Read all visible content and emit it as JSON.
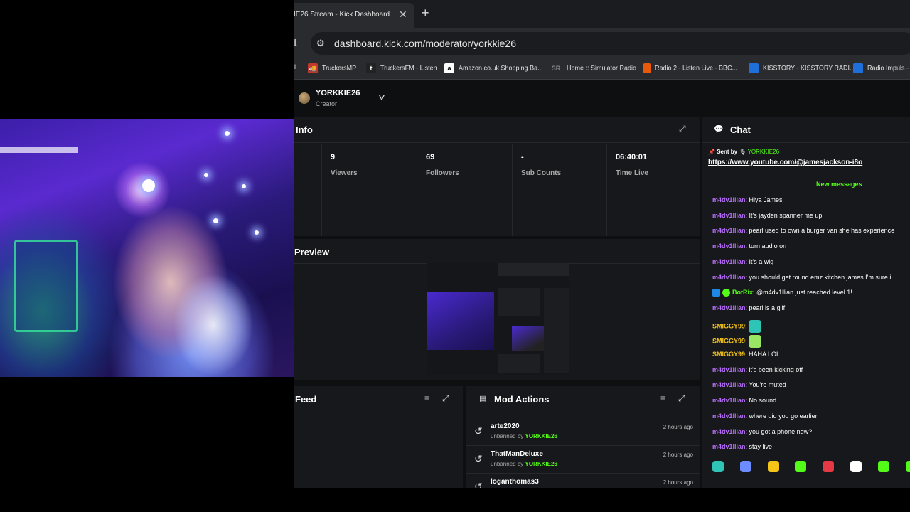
{
  "browser": {
    "tab_title": "IE26 Stream - Kick Dashboard",
    "tab_close": "✕",
    "new_tab": "+",
    "back_glyph": "ℹ",
    "url": "dashboard.kick.com/moderator/yorkkie26",
    "bookmarks": [
      {
        "label": "TruckersMP",
        "icon": "T",
        "color": "#c0392b"
      },
      {
        "label": "TruckersFM - Listen",
        "icon": "t",
        "color": "#222222"
      },
      {
        "label": "Amazon.co.uk Shopping Ba...",
        "icon": "a",
        "color": "#ffffff"
      },
      {
        "label": "Home :: Simulator Radio",
        "icon": "SR",
        "color": "#555555"
      },
      {
        "label": "Radio 2 - Listen Live - BBC...",
        "icon": "",
        "color": "#e8590c"
      },
      {
        "label": "KISSTORY - KISSTORY RADI...",
        "icon": "",
        "color": "#1e6fd9"
      },
      {
        "label": "Radio Impuls - L",
        "icon": "",
        "color": "#1e6fd9"
      }
    ],
    "bookmark_first_fragment": "il"
  },
  "user": {
    "name": "YORKKIE26",
    "role": "Creator"
  },
  "info": {
    "title": "Info",
    "stats": [
      {
        "value": "9",
        "label": "Viewers"
      },
      {
        "value": "69",
        "label": "Followers"
      },
      {
        "value": "-",
        "label": "Sub Counts"
      },
      {
        "value": "06:40:01",
        "label": "Time Live"
      }
    ]
  },
  "preview": {
    "title": "Preview"
  },
  "feed": {
    "title": "Feed"
  },
  "mod_actions": {
    "title": "Mod Actions",
    "items": [
      {
        "name": "arte2020",
        "action": "unbanned by",
        "by": "YORKKIE26",
        "time": "2 hours ago"
      },
      {
        "name": "ThatManDeluxe",
        "action": "unbanned by",
        "by": "YORKKIE26",
        "time": "2 hours ago"
      },
      {
        "name": "loganthomas3",
        "action": "",
        "by": "",
        "time": "2 hours ago"
      }
    ]
  },
  "chat": {
    "title": "Chat",
    "pinned_sent_by": "Sent by",
    "pinned_user": "YORKKIE26",
    "pinned_link": "https://www.youtube.com/@jamesjackson-i8o",
    "new_messages": "New messages",
    "messages": [
      {
        "user": "m4dv1llian",
        "text": "Hiya James",
        "color": "#b46cf7"
      },
      {
        "user": "m4dv1llian",
        "text": "It's jayden spanner me up",
        "color": "#b46cf7"
      },
      {
        "user": "m4dv1llian",
        "text": "pearl used to own a burger van she has experience",
        "color": "#b46cf7"
      },
      {
        "user": "m4dv1llian",
        "text": "turn audio on",
        "color": "#b46cf7"
      },
      {
        "user": "m4dv1llian",
        "text": "It's a wig",
        "color": "#b46cf7"
      },
      {
        "user": "m4dv1llian",
        "text": "you should get round emz kitchen james I'm sure i",
        "color": "#b46cf7"
      },
      {
        "user": "BotRix",
        "text": "@m4dv1llian just reached level 1!",
        "color": "#53fc18",
        "badges": true
      },
      {
        "user": "m4dv1llian",
        "text": "pearl is a gilf",
        "color": "#b46cf7"
      },
      {
        "user": "SMIGGY99",
        "text": "",
        "color": "#f5c518",
        "emote": "#2ec4b6"
      },
      {
        "user": "SMIGGY99",
        "text": "",
        "color": "#f5c518",
        "emote": "#9be564"
      },
      {
        "user": "SMIGGY99",
        "text": "HAHA LOL",
        "color": "#f5c518"
      },
      {
        "user": "m4dv1llian",
        "text": "it's been kicking off",
        "color": "#b46cf7"
      },
      {
        "user": "m4dv1llian",
        "text": "You're muted",
        "color": "#b46cf7"
      },
      {
        "user": "m4dv1llian",
        "text": "No sound",
        "color": "#b46cf7"
      },
      {
        "user": "m4dv1llian",
        "text": "where did you go earlier",
        "color": "#b46cf7"
      },
      {
        "user": "m4dv1llian",
        "text": "you got a phone now?",
        "color": "#b46cf7"
      },
      {
        "user": "m4dv1llian",
        "text": "stay live",
        "color": "#b46cf7"
      }
    ],
    "emote_colors": [
      "#2ec4b6",
      "#6c8cff",
      "#f5c518",
      "#53fc18",
      "#e63946",
      "#ffffff",
      "#53fc18",
      "#53fc18"
    ]
  },
  "colors": {
    "accent": "#53fc18",
    "panel": "#17181b",
    "bg": "#0e0f11"
  }
}
